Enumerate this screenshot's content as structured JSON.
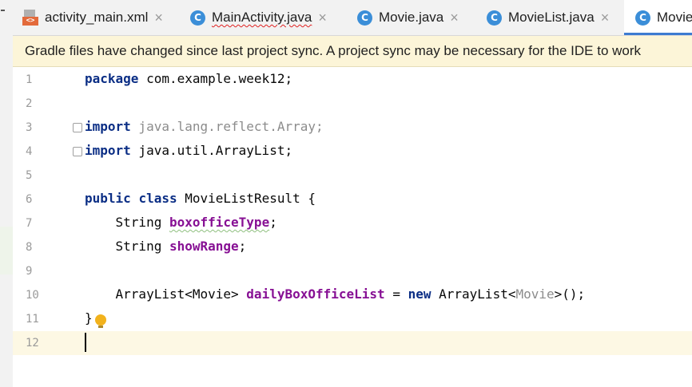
{
  "tabs": [
    {
      "label": "activity_main.xml",
      "icon": "xml-file-icon",
      "active": false,
      "error": false
    },
    {
      "label": "MainActivity.java",
      "icon": "class-c-icon",
      "active": false,
      "error": true
    },
    {
      "label": "Movie.java",
      "icon": "class-c-icon",
      "active": false,
      "error": false
    },
    {
      "label": "MovieList.java",
      "icon": "class-c-icon",
      "active": false,
      "error": false
    },
    {
      "label": "Movie",
      "icon": "class-c-icon",
      "active": true,
      "error": false
    }
  ],
  "tab_close": "×",
  "class_icon_letter": "C",
  "xml_icon_text": "<>",
  "banner": {
    "text": "Gradle files have changed since last project sync. A project sync may be necessary for the IDE to work"
  },
  "editor": {
    "line_numbers": [
      "1",
      "2",
      "3",
      "4",
      "5",
      "6",
      "7",
      "8",
      "9",
      "10",
      "11",
      "12"
    ],
    "current_line": "12",
    "code": {
      "l1_kw": "package",
      "l1_rest": " com.example.week12;",
      "l3_kw": "import",
      "l3_rest": " java.lang.reflect.Array;",
      "l4_kw": "import",
      "l4_rest": " java.util.ArrayList;",
      "l6_kw1": "public",
      "l6_kw2": "class",
      "l6_rest": " MovieListResult {",
      "l7_type": "    String ",
      "l7_field": "boxofficeType",
      "l7_end": ";",
      "l8_type": "    String ",
      "l8_field": "showRange",
      "l8_end": ";",
      "l10_type": "    ArrayList<Movie> ",
      "l10_field": "dailyBoxOfficeList",
      "l10_eq": " = ",
      "l10_kw": "new",
      "l10_a": " ArrayList<",
      "l10_gen": "Movie",
      "l10_b": ">();",
      "l11": "}"
    }
  },
  "colors": {
    "accent": "#3d7bd1",
    "banner_bg": "#fcf5d8",
    "keyword": "#0b2e85",
    "field": "#871094",
    "current_line": "#fdf8e4"
  }
}
